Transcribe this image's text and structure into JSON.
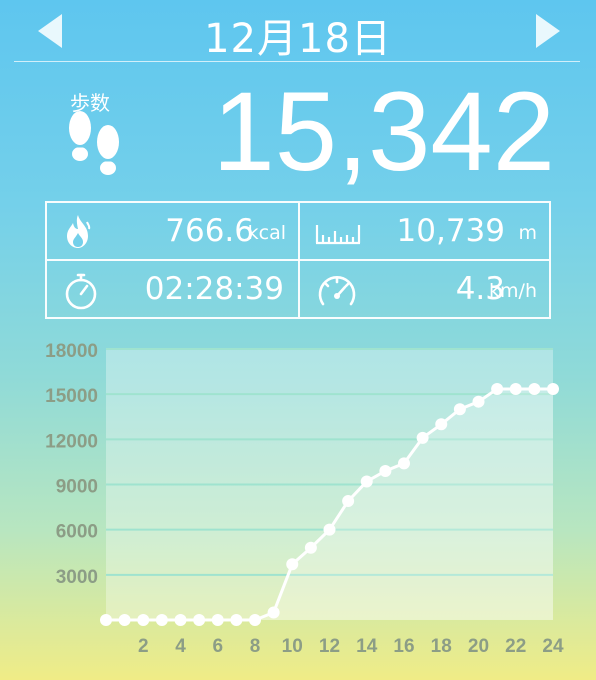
{
  "header": {
    "date": "12月18日"
  },
  "summary": {
    "steps_label": "歩数",
    "steps": "15,342",
    "calories": {
      "value": "766.6",
      "unit": "kcal"
    },
    "distance": {
      "value": "10,739",
      "unit": "m"
    },
    "duration": {
      "value": "02:28:39"
    },
    "speed": {
      "value": "4.3",
      "unit": "km/h"
    }
  },
  "icons": [
    "chevron-left-icon",
    "chevron-right-icon",
    "footprints-icon",
    "flame-icon",
    "ruler-icon",
    "stopwatch-icon",
    "speedometer-icon"
  ],
  "chart_data": {
    "type": "line",
    "x": [
      0,
      1,
      2,
      3,
      4,
      5,
      6,
      7,
      8,
      9,
      10,
      11,
      12,
      13,
      14,
      15,
      16,
      17,
      18,
      19,
      20,
      21,
      22,
      23,
      24
    ],
    "values": [
      0,
      0,
      0,
      0,
      0,
      0,
      0,
      0,
      0,
      500,
      3700,
      4800,
      6000,
      7900,
      9200,
      9900,
      10400,
      12100,
      13000,
      14000,
      14500,
      15342,
      15342,
      15342,
      15342
    ],
    "x_tick_labels": [
      "2",
      "4",
      "6",
      "8",
      "10",
      "12",
      "14",
      "16",
      "18",
      "20",
      "22",
      "24"
    ],
    "y_tick_labels": [
      "3000",
      "6000",
      "9000",
      "12000",
      "15000",
      "18000"
    ],
    "xlim": [
      0,
      24
    ],
    "ylim": [
      0,
      18000
    ],
    "grid": true,
    "colors": {
      "line": "#ffffff",
      "fill": "#ffffff",
      "grid": "#9fe3cf",
      "tick_labels": "#8c9d86"
    }
  }
}
